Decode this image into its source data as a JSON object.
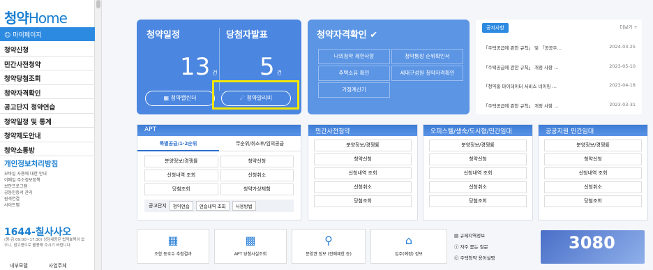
{
  "sidebar": {
    "logo_a": "청약",
    "logo_b": "Home",
    "mypage": "마이페이지",
    "menu": [
      "청약신청",
      "민간사전청약",
      "청약당첨조회",
      "청약자격확인",
      "공고단지 청약연습",
      "청약일정 및 통계",
      "청약제도안내",
      "청약소통방"
    ],
    "privacy_title": "개인정보처리방침",
    "privacy_items": [
      "모바일 사용에 대한 안내",
      "이메일 주소정보정책",
      "보안프로그램",
      "공동인증서 관리",
      "원격연결",
      "사이트맵"
    ],
    "phone": "1644-칠사사오",
    "phone_desc": "(평-금 09:00~17:30) 상담내용은 법적효력이 없으니, 참고용으로 활용해 주시기 바랍니다.",
    "bottom": [
      "내부모델",
      "사업주체"
    ]
  },
  "card1": {
    "h1": "청약일정",
    "h2": "당첨자발표",
    "n1": "13",
    "n2": "5",
    "unit": "건",
    "btn1": "청약캘린더",
    "btn2": "청약알리미"
  },
  "card2": {
    "title": "청약자격확인",
    "items": [
      "나의청약 제한사항",
      "청약통장 순위확인서",
      "주택소유 확인",
      "세대구성원 청약자격확인",
      "가점계산기"
    ]
  },
  "notice": {
    "tag": "공지사항",
    "more": "더보기 +",
    "rows": [
      {
        "t": "「주택공급에 관한 규칙」 및 「공공주…",
        "d": "2024-03-25"
      },
      {
        "t": "「주택공급에 관한 규칙」 개정 사항 …",
        "d": "2023-05-10"
      },
      {
        "t": "「청약홈 마이데이터 서비스 네이밍 …",
        "d": "2023-04-18"
      },
      {
        "t": "「주택공급에 관한 규칙」 개정 사항 …",
        "d": "2023-03-31"
      }
    ]
  },
  "apt": {
    "title": "APT",
    "tab1": "특별공급/1·2순위",
    "tab2": "무순위/취소후/임의공급",
    "grid": [
      "분양정보/경쟁률",
      "청약신청",
      "신청내역 조회",
      "신청취소",
      "당첨조회",
      "청약가상체험"
    ],
    "bar_label": "공고단지",
    "bar": [
      "청약연습",
      "연습내역 조회",
      "사용방법"
    ]
  },
  "panels": [
    {
      "title": "민간사전청약",
      "items": [
        "분양정보/경쟁률",
        "청약신청",
        "신청내역 조회",
        "신청취소",
        "당첨조회"
      ]
    },
    {
      "title": "오피스텔/생숙/도시형/민간임대",
      "items": [
        "분양정보/경쟁률",
        "청약신청",
        "신청내역 조회",
        "신청취소",
        "당첨조회"
      ]
    },
    {
      "title": "공공지원 민간임대",
      "items": [
        "분양정보/경쟁률",
        "청약신청",
        "신청내역 조회",
        "신청취소",
        "당첨조회"
      ]
    }
  ],
  "quick": [
    "조합 동호수 추첨결과",
    "APT 당첨사실조회",
    "분양권 정보 (전매제한 등)",
    "입주(예정) 정보"
  ],
  "rlinks": [
    "규제지역정보",
    "자주 묻는 질문",
    "주택청약 용어설명"
  ],
  "banner": "3080"
}
